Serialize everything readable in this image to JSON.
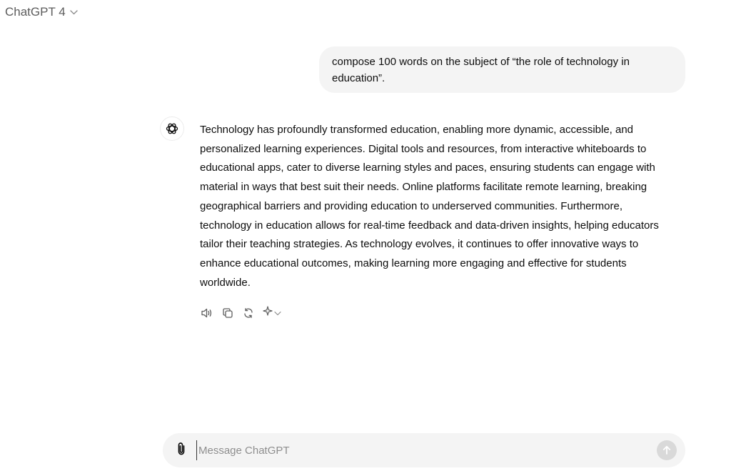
{
  "header": {
    "model_name": "ChatGPT 4",
    "dropdown_icon": "chevron-down-icon"
  },
  "conversation": {
    "user_message": "compose 100 words on the subject of “the role of technology in education”.",
    "assistant_message": "Technology has profoundly transformed education, enabling more dynamic, accessible, and personalized learning experiences. Digital tools and resources, from interactive whiteboards to educational apps, cater to diverse learning styles and paces, ensuring students can engage with material in ways that best suit their needs. Online platforms facilitate remote learning, breaking geographical barriers and providing education to underserved communities. Furthermore, technology in education allows for real-time feedback and data-driven insights, helping educators tailor their teaching strategies. As technology evolves, it continues to offer innovative ways to enhance educational outcomes, making learning more engaging and effective for students worldwide.",
    "assistant_avatar_icon": "openai-logo-icon",
    "actions": [
      {
        "name": "read-aloud",
        "icon": "speaker-icon"
      },
      {
        "name": "copy",
        "icon": "copy-icon"
      },
      {
        "name": "regenerate",
        "icon": "refresh-icon"
      },
      {
        "name": "change-model",
        "icon": "sparkle-icon"
      }
    ]
  },
  "composer": {
    "placeholder": "Message ChatGPT",
    "value": "",
    "attach_icon": "paperclip-icon",
    "send_icon": "arrow-up-icon"
  },
  "colors": {
    "bubble_bg": "#f4f4f4",
    "text": "#0d0d0d",
    "muted": "#5d5d5d",
    "send_disabled": "#d9d9d9"
  }
}
